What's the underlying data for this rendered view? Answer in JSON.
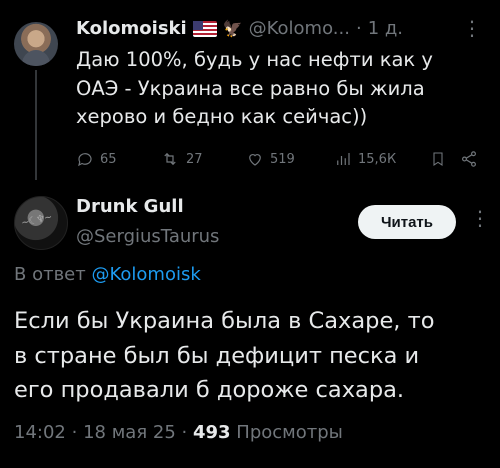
{
  "parent": {
    "name": "Kolomoiski",
    "handle": "@Kolomo...",
    "separator": "·",
    "time": "1 д.",
    "more": "⋮",
    "text": "Даю 100%, будь у нас нефти как у\nОАЭ - Украина все равно бы жила\nхерово и бедно как сейчас))",
    "replies": "65",
    "retweets": "27",
    "likes": "519",
    "views": "15,6К",
    "icons": [
      "flag-usa-icon",
      "eagle-icon",
      "reply-icon",
      "retweet-icon",
      "like-icon",
      "views-icon",
      "bookmark-icon",
      "share-icon"
    ]
  },
  "reply": {
    "name": "Drunk Gull",
    "handle": "@SergiusTaurus",
    "follow_label": "Читать",
    "more": "⋮",
    "reply_to_prefix": "В ответ",
    "reply_to_handle": "@Kolomoisk",
    "text": "Если бы Украина была в Сахаре, то\nв стране был бы дефицит песка и\nего продавали б дороже сахара.",
    "time": "14:02",
    "date": "18 мая 25",
    "dot": "·",
    "views_count": "493",
    "views_label": "Просмотры"
  },
  "colors": {
    "background": "#000000",
    "text": "#e7e9ea",
    "muted": "#71767b",
    "link": "#1d9bf0",
    "button_bg": "#eff3f4"
  }
}
